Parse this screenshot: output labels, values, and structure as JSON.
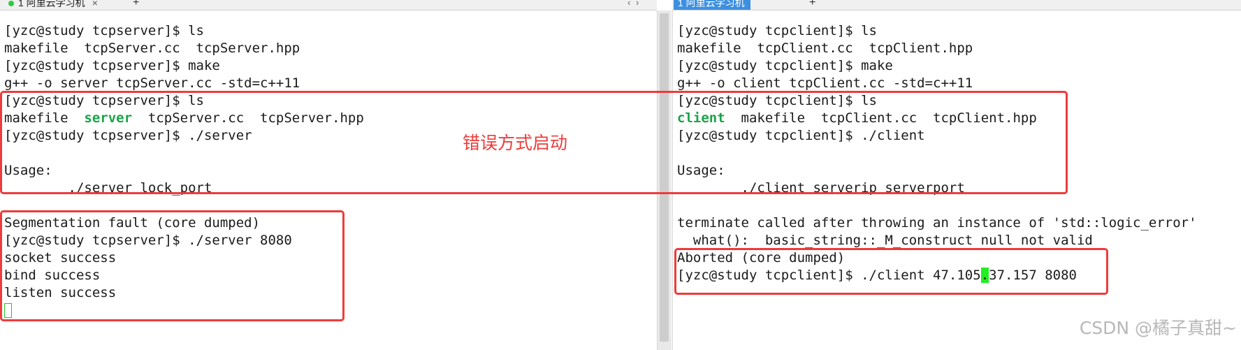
{
  "tabs": [
    {
      "label": "1 阿里云学习机",
      "close": "×"
    },
    {
      "label": "1 阿里云学习机",
      "close": ""
    }
  ],
  "tab_new": "+",
  "tab_nav": "‹ ›",
  "left_terminal": {
    "lines": [
      [
        {
          "t": "[yzc@study tcpserver]$ ls"
        }
      ],
      [
        {
          "t": "makefile  tcpServer.cc  tcpServer.hpp"
        }
      ],
      [
        {
          "t": "[yzc@study tcpserver]$ make"
        }
      ],
      [
        {
          "t": "g++ -o server tcpServer.cc -std=c++11"
        }
      ],
      [
        {
          "t": "[yzc@study tcpserver]$ ls"
        }
      ],
      [
        {
          "t": "makefile  "
        },
        {
          "t": "server",
          "exe": true
        },
        {
          "t": "  tcpServer.cc  tcpServer.hpp"
        }
      ],
      [
        {
          "t": "[yzc@study tcpserver]$ ./server"
        }
      ],
      [
        {
          "t": ""
        }
      ],
      [
        {
          "t": "Usage:"
        }
      ],
      [
        {
          "t": "        ./server lock_port"
        }
      ],
      [
        {
          "t": ""
        }
      ],
      [
        {
          "t": "Segmentation fault (core dumped)"
        }
      ],
      [
        {
          "t": "[yzc@study tcpserver]$ ./server 8080"
        }
      ],
      [
        {
          "t": "socket success"
        }
      ],
      [
        {
          "t": "bind success"
        }
      ],
      [
        {
          "t": "listen success"
        }
      ],
      [
        {
          "t": "",
          "cursor_box": true
        }
      ]
    ]
  },
  "right_terminal": {
    "lines": [
      [
        {
          "t": "[yzc@study tcpclient]$ ls"
        }
      ],
      [
        {
          "t": "makefile  tcpClient.cc  tcpClient.hpp"
        }
      ],
      [
        {
          "t": "[yzc@study tcpclient]$ make"
        }
      ],
      [
        {
          "t": "g++ -o client tcpClient.cc -std=c++11"
        }
      ],
      [
        {
          "t": "[yzc@study tcpclient]$ ls"
        }
      ],
      [
        {
          "t": "client",
          "exe": true
        },
        {
          "t": "  makefile  tcpClient.cc  tcpClient.hpp"
        }
      ],
      [
        {
          "t": "[yzc@study tcpclient]$ ./client"
        }
      ],
      [
        {
          "t": ""
        }
      ],
      [
        {
          "t": "Usage:"
        }
      ],
      [
        {
          "t": "        ./client serverip serverport"
        }
      ],
      [
        {
          "t": ""
        }
      ],
      [
        {
          "t": "terminate called after throwing an instance of 'std::logic_error'"
        }
      ],
      [
        {
          "t": "  what():  basic_string::_M_construct null not valid"
        }
      ],
      [
        {
          "t": "Aborted (core dumped)"
        }
      ],
      [
        {
          "t": "[yzc@study tcpclient]$ ./client 47.105"
        },
        {
          "t": ".",
          "cursor": true
        },
        {
          "t": "37.157 8080"
        }
      ]
    ]
  },
  "annotation": {
    "text": "错误方式启动",
    "color": "#ee3b3b"
  },
  "watermark": "CSDN @橘子真甜~",
  "colors": {
    "executable": "#1aa34a",
    "cursor": "#22ee22",
    "highlight": "#ee3b3b"
  }
}
